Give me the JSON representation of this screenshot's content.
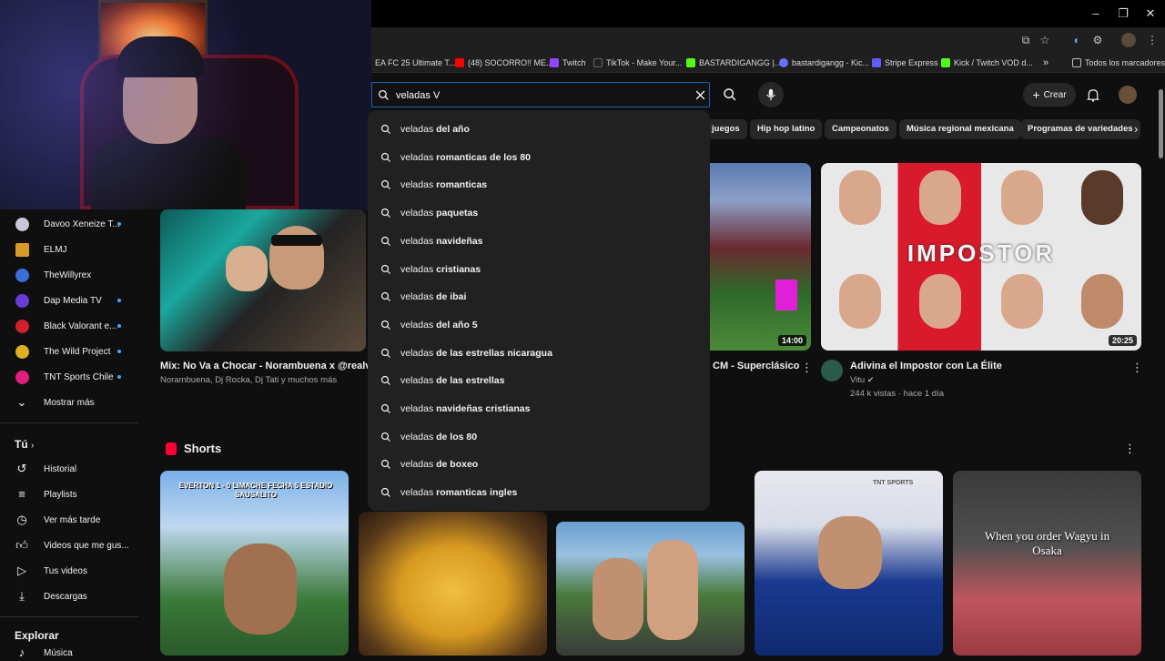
{
  "browser": {
    "bookmarks": [
      {
        "label": "EA FC 25 Ultimate T...",
        "color": "#1f1f1f"
      },
      {
        "label": "(48) SOCORRO!! ME...",
        "color": "#ff0000"
      },
      {
        "label": "Twitch",
        "color": "#9146ff"
      },
      {
        "label": "TikTok - Make Your...",
        "color": "#000000"
      },
      {
        "label": "BASTARDIGANGG |...",
        "color": "#53fc18"
      },
      {
        "label": "bastardigangg - Kic...",
        "color": "#6f6fff"
      },
      {
        "label": "Stripe Express",
        "color": "#635bff"
      },
      {
        "label": "Kick / Twitch VOD d...",
        "color": "#53fc18"
      }
    ],
    "all_bookmarks": "Todos los marcadores"
  },
  "sidebar": {
    "subscriptions": [
      {
        "label": "Davoo Xeneize T...",
        "live": true,
        "color": "#c9c9d9"
      },
      {
        "label": "ELMJ",
        "live": false,
        "color": "#d79a2a"
      },
      {
        "label": "TheWillyrex",
        "live": false,
        "color": "#3a6fd8"
      },
      {
        "label": "Dap Media TV",
        "live": true,
        "color": "#6a3bd8"
      },
      {
        "label": "Black Valorant e...",
        "live": true,
        "color": "#d0202a"
      },
      {
        "label": "The Wild Project",
        "live": true,
        "color": "#e0b020"
      },
      {
        "label": "TNT Sports Chile",
        "live": true,
        "color": "#e0207a"
      }
    ],
    "show_more": "Mostrar más",
    "you_heading": "Tú",
    "you_items": [
      {
        "label": "Historial",
        "icon": "history-icon"
      },
      {
        "label": "Playlists",
        "icon": "playlists-icon"
      },
      {
        "label": "Ver más tarde",
        "icon": "watch-later-icon"
      },
      {
        "label": "Videos que me gus...",
        "icon": "like-icon"
      },
      {
        "label": "Tus videos",
        "icon": "your-videos-icon"
      },
      {
        "label": "Descargas",
        "icon": "downloads-icon"
      }
    ],
    "explore_heading": "Explorar",
    "explore_partial": "Música"
  },
  "header": {
    "search_value": "veladas V",
    "create_label": "Crear"
  },
  "chips": [
    "juegos",
    "Hip hop latino",
    "Campeonatos",
    "Música regional mexicana",
    "Programas de variedades"
  ],
  "suggestions": [
    {
      "prefix": "veladas",
      "rest": " del año"
    },
    {
      "prefix": "veladas",
      "rest": " romanticas de los 80"
    },
    {
      "prefix": "veladas",
      "rest": " romanticas"
    },
    {
      "prefix": "veladas",
      "rest": " paquetas"
    },
    {
      "prefix": "veladas",
      "rest": " navideñas"
    },
    {
      "prefix": "veladas",
      "rest": " cristianas"
    },
    {
      "prefix": "veladas",
      "rest": " de ibai"
    },
    {
      "prefix": "veladas",
      "rest": " del año 5"
    },
    {
      "prefix": "veladas",
      "rest": " de las estrellas nicaragua"
    },
    {
      "prefix": "veladas",
      "rest": " de las estrellas"
    },
    {
      "prefix": "veladas",
      "rest": " navideñas cristianas"
    },
    {
      "prefix": "veladas",
      "rest": " de los 80"
    },
    {
      "prefix": "veladas",
      "rest": " de boxeo"
    },
    {
      "prefix": "veladas",
      "rest": " romanticas ingles"
    }
  ],
  "videos": [
    {
      "title": "Mix: No Va a Chocar - Norambuena x @realvivie",
      "meta": "Norambuena, Dj Rocka, Dj Tati y muchos más"
    },
    {
      "title": "CM - Superclásico",
      "duration": "14:00"
    },
    {
      "title": "Adivina el Impostor con La Élite",
      "channel": "Vitu",
      "meta": "244 k vistas · hace 1 día",
      "duration": "20:25",
      "overlay_text": "IMPOSTOR"
    }
  ],
  "shorts": {
    "heading": "Shorts",
    "items": [
      {
        "overlay": "EVERTON 1 - 0 LIMACHE FECHA 5 ESTADIO SAUSALITO"
      },
      {
        "overlay": ""
      },
      {
        "overlay": ""
      },
      {
        "overlay": "TNT SPORTS"
      },
      {
        "overlay": "When you order Wagyu in Osaka"
      }
    ]
  }
}
